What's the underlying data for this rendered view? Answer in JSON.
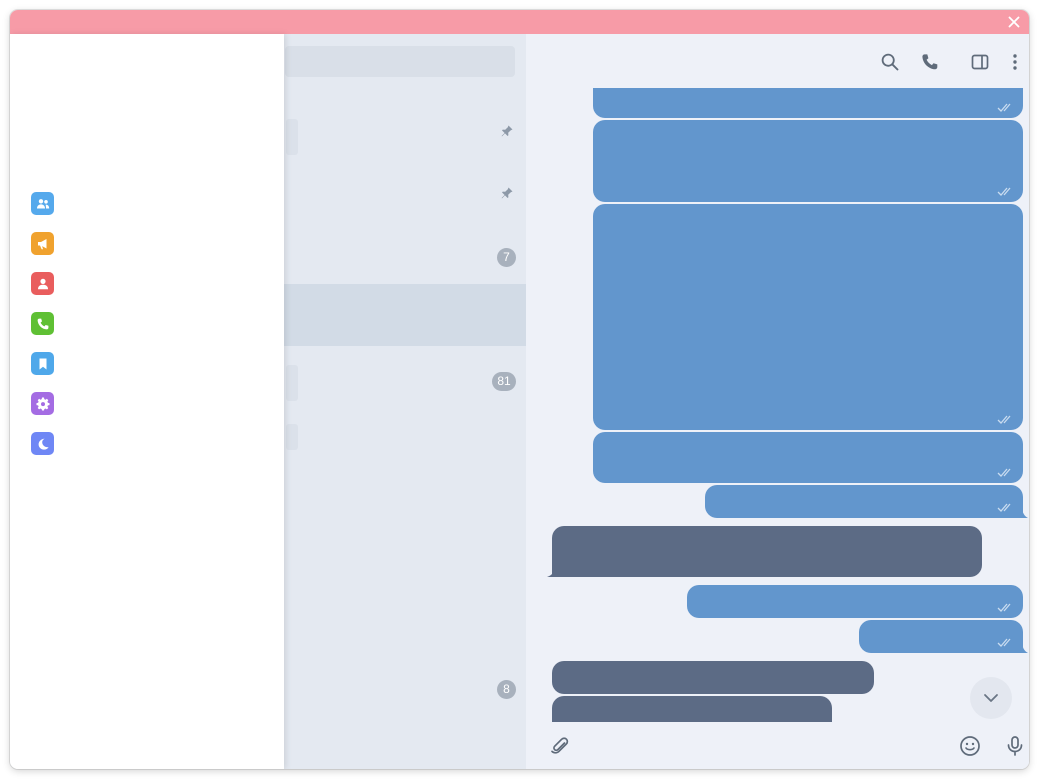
{
  "window": {
    "titlebar_color": "#f79ba7"
  },
  "chat_list": {
    "rows": [
      {
        "pinned": true,
        "badge": ""
      },
      {
        "pinned": true,
        "badge": ""
      },
      {
        "pinned": false,
        "badge": "7"
      },
      {
        "pinned": false,
        "badge": "",
        "active": true
      },
      {
        "pinned": false,
        "badge": "81"
      },
      {
        "pinned": false,
        "badge": ""
      },
      {
        "pinned": false,
        "badge": "8"
      }
    ]
  },
  "drawer": {
    "menu_items": [
      {
        "icon": "new-group-icon",
        "color": "#55a9ec"
      },
      {
        "icon": "new-channel-icon",
        "color": "#f0a22e"
      },
      {
        "icon": "contacts-icon",
        "color": "#e95d5d"
      },
      {
        "icon": "calls-icon",
        "color": "#5fc034"
      },
      {
        "icon": "saved-messages-icon",
        "color": "#4fa8ea"
      },
      {
        "icon": "settings-icon",
        "color": "#a46ce3"
      },
      {
        "icon": "night-mode-icon",
        "color": "#6f87f5"
      }
    ]
  },
  "colors": {
    "outgoing_bubble": "#6296cd",
    "incoming_bubble": "#5c6b85",
    "chat_background": "#eef1f8",
    "icon_gray": "#5f6b7a"
  }
}
